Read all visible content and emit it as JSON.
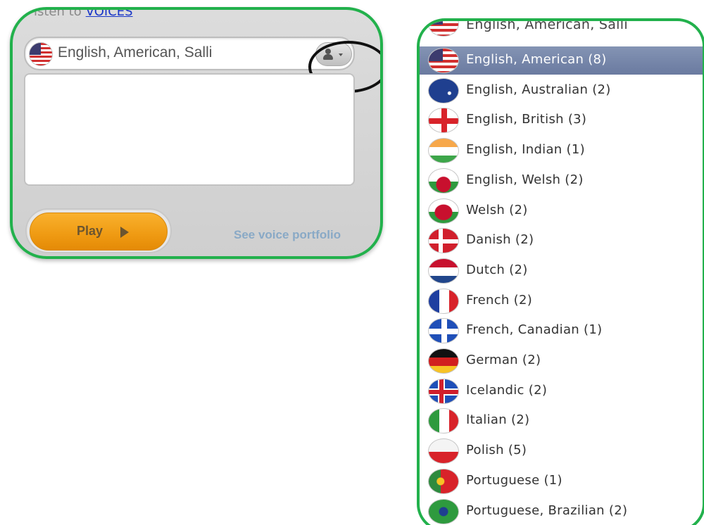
{
  "widget": {
    "listen_prefix": "isten to",
    "listen_link": "VOICES",
    "selected_voice": "English, American, Salli",
    "play_label": "Play",
    "portfolio_link": "See voice portfolio"
  },
  "dropdown": {
    "items": [
      {
        "label": "English, American, Salli",
        "flag": "us"
      },
      {
        "label": "English, American (8)",
        "flag": "us",
        "selected": true
      },
      {
        "label": "English, Australian (2)",
        "flag": "au"
      },
      {
        "label": "English, British (3)",
        "flag": "gb"
      },
      {
        "label": "English, Indian (1)",
        "flag": "in"
      },
      {
        "label": "English, Welsh (2)",
        "flag": "gb-wls"
      },
      {
        "label": "Welsh (2)",
        "flag": "wls"
      },
      {
        "label": "Danish (2)",
        "flag": "dk"
      },
      {
        "label": "Dutch (2)",
        "flag": "nl"
      },
      {
        "label": "French (2)",
        "flag": "fr"
      },
      {
        "label": "French, Canadian (1)",
        "flag": "qc"
      },
      {
        "label": "German (2)",
        "flag": "de"
      },
      {
        "label": "Icelandic (2)",
        "flag": "is"
      },
      {
        "label": "Italian (2)",
        "flag": "it"
      },
      {
        "label": "Polish (5)",
        "flag": "pl"
      },
      {
        "label": "Portuguese (1)",
        "flag": "pt"
      },
      {
        "label": "Portuguese, Brazilian (2)",
        "flag": "br"
      }
    ]
  },
  "colors": {
    "frame_green": "#22b14c",
    "play_orange": "#f0a020",
    "selected_row": "#7585a8",
    "link_blue": "#1a37c8"
  },
  "icons": {
    "voice_button": "person-icon",
    "play": "play-triangle-icon"
  }
}
